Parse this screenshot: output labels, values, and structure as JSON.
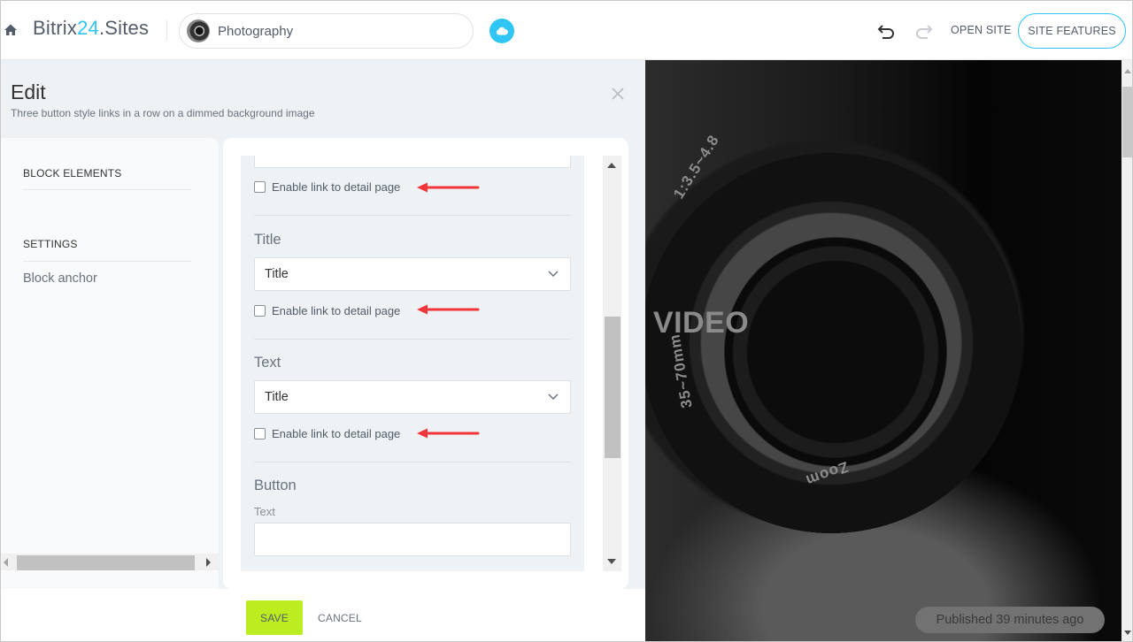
{
  "app": {
    "logo_main": "Bitrix",
    "logo_accent": "24",
    "logo_suffix": ".Sites",
    "site_name": "Photography",
    "actions": {
      "open_site": "OPEN SITE",
      "site_features": "SITE FEATURES"
    },
    "icons": {
      "home": "home-icon",
      "cloud": "cloud-icon",
      "undo": "undo-icon",
      "redo": "redo-icon"
    },
    "colors": {
      "accent": "#2fc6f6",
      "save": "#bbed21",
      "annotation_arrow": "#f2353b"
    }
  },
  "editor": {
    "title": "Edit",
    "subtitle": "Three button style links in a row on a dimmed background image",
    "nav": {
      "block_elements": "BLOCK ELEMENTS",
      "settings": "SETTINGS",
      "items": [
        {
          "label": "Block anchor"
        }
      ]
    },
    "form": {
      "top_field_value": "",
      "checkbox_label": "Enable link to detail page",
      "sections": [
        {
          "title": "Title",
          "select_value": "Title",
          "checkbox_label": "Enable link to detail page",
          "checked": false
        },
        {
          "title": "Text",
          "select_value": "Title",
          "checkbox_label": "Enable link to detail page",
          "checked": false
        }
      ],
      "button_section": {
        "title": "Button",
        "text_label": "Text",
        "text_value": ""
      }
    },
    "footer": {
      "save": "SAVE",
      "cancel": "CANCEL"
    }
  },
  "preview": {
    "heading_fragment": "O VIDEO",
    "lens_text_top": "1:3.5~4.8",
    "lens_text_side": "35~70mm",
    "lens_text_bottom": "Zoom",
    "published_status": "Published 39 minutes ago"
  }
}
